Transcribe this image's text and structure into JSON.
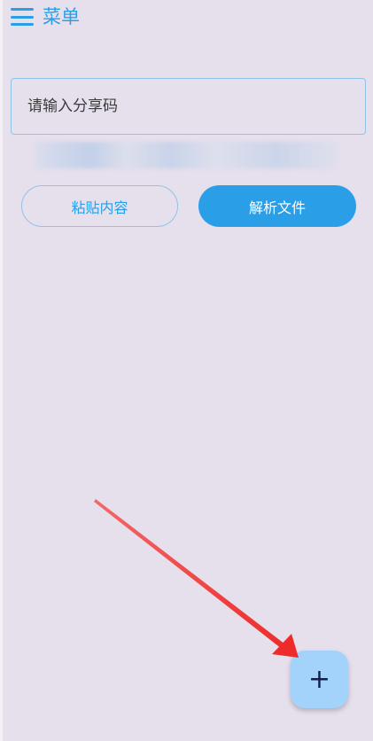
{
  "header": {
    "menu_icon": "hamburger-menu-icon",
    "title": "菜单"
  },
  "share_code": {
    "value": "",
    "placeholder": "请输入分享码"
  },
  "buttons": {
    "paste_label": "粘贴内容",
    "parse_label": "解析文件"
  },
  "fab": {
    "icon": "plus-icon",
    "label": "+"
  },
  "colors": {
    "background": "#e6dfec",
    "accent": "#2a9fe8",
    "primary_button": "#2a9fe8",
    "outline": "#8fc4ea",
    "fab_background": "#a3d2fb",
    "annotation_arrow": "#ee2b2b"
  }
}
